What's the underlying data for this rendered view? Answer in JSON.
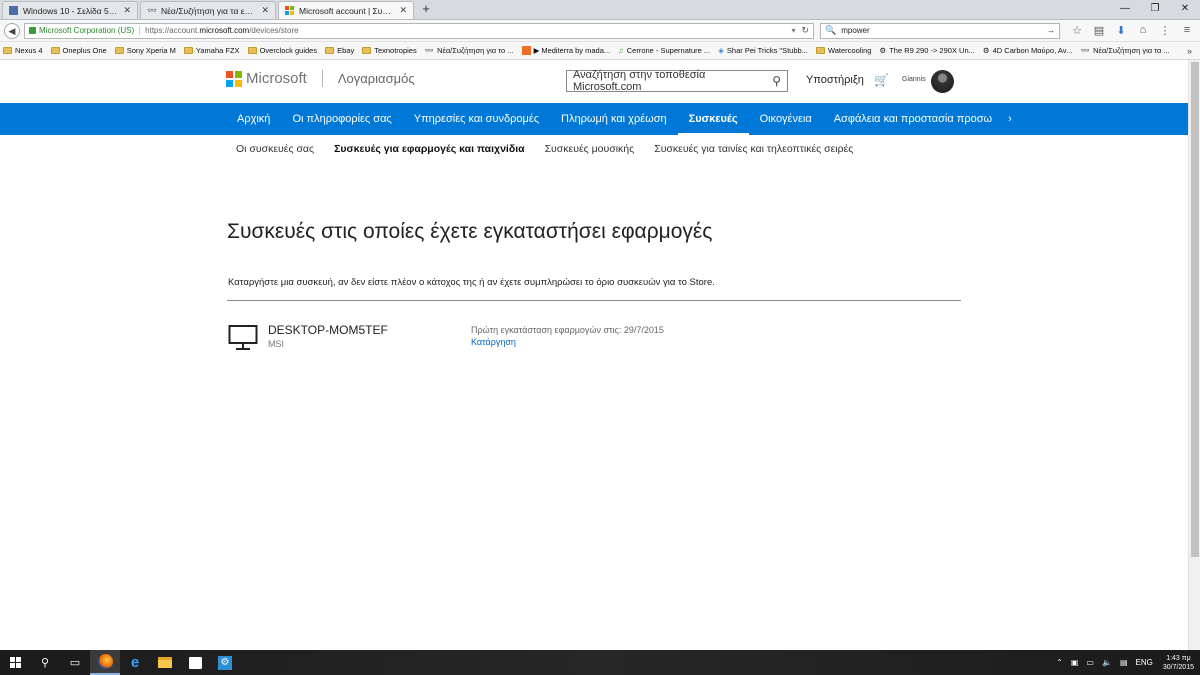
{
  "browser": {
    "tabs": [
      {
        "title": "Windows 10 - Σελίδα 5 - Λε...",
        "icon": "forum-favicon",
        "active": false
      },
      {
        "title": "Νέα/Συζήτηση για τα επερ...",
        "icon": "insomnia-favicon",
        "active": false
      },
      {
        "title": "Microsoft account | Συσκε...",
        "icon": "microsoft-favicon",
        "active": true
      }
    ],
    "identity": "Microsoft Corporation (US)",
    "url_prefix": "https://account.",
    "url_host": "microsoft.com",
    "url_path": "/devices/store",
    "search_value": "mpower",
    "bookmarks": [
      "Nexus 4",
      "Oneplus One",
      "Sony Xperia M",
      "Yamaha FZX",
      "Overclock guides",
      "Ebay",
      "Texnotropies",
      "Νέα/Συζήτηση για το ...",
      "Mediterra by mada...",
      "Cerrone - Supernature ...",
      "Shar Pei Tricks \"Stubb...",
      "Watercooling",
      "The R9 290 -> 290X Un...",
      "4D Carbon Μαύρο, Αν...",
      "Νέα/Συζήτηση για τα ..."
    ]
  },
  "header": {
    "brand": "Microsoft",
    "section": "Λογαριασμός",
    "search_placeholder": "Αναζήτηση στην τοποθεσία Microsoft.com",
    "support": "Υποστήριξη",
    "user": "Giannis"
  },
  "main_nav": [
    "Αρχική",
    "Οι πληροφορίες σας",
    "Υπηρεσίες και συνδρομές",
    "Πληρωμή και χρέωση",
    "Συσκευές",
    "Οικογένεια",
    "Ασφάλεια και προστασία προσω"
  ],
  "main_nav_active": "Συσκευές",
  "sub_nav": [
    "Οι συσκευές σας",
    "Συσκευές για εφαρμογές και παιχνίδια",
    "Συσκευές μουσικής",
    "Συσκευές για ταινίες και τηλεοπτικές σειρές"
  ],
  "sub_nav_active": "Συσκευές για εφαρμογές και παιχνίδια",
  "content": {
    "title": "Συσκευές στις οποίες έχετε εγκαταστήσει εφαρμογές",
    "intro": "Καταργήστε μια συσκευή, αν δεν είστε πλέον ο κάτοχος της ή αν έχετε συμπληρώσει το όριο συσκευών για το Store.",
    "device": {
      "name": "DESKTOP-MOM5TEF",
      "maker": "MSI",
      "first_install": "Πρώτη εγκατάσταση εφαρμογών στις: 29/7/2015",
      "remove": "Κατάργηση"
    }
  },
  "taskbar": {
    "language": "ENG",
    "time": "1:43 πμ",
    "date": "30/7/2015"
  },
  "colors": {
    "accent": "#0078d7",
    "link": "#0066cc",
    "ms_red": "#f25022",
    "ms_green": "#7fba00",
    "ms_blue": "#00a4ef",
    "ms_yellow": "#ffb900"
  }
}
